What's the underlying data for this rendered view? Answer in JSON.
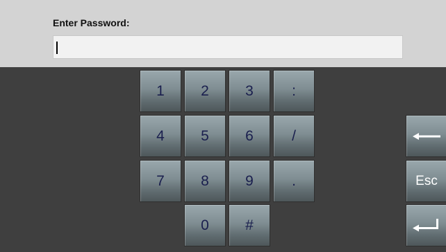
{
  "prompt": {
    "label": "Enter Password:"
  },
  "password": {
    "value": ""
  },
  "keypad": {
    "rows": [
      [
        "1",
        "2",
        "3",
        ":"
      ],
      [
        "4",
        "5",
        "6",
        "/"
      ],
      [
        "7",
        "8",
        "9",
        "."
      ],
      [
        "0",
        "#"
      ]
    ]
  },
  "side_keys": {
    "backspace_icon": "backspace-arrow-icon",
    "esc_label": "Esc",
    "enter_icon": "enter-return-icon"
  },
  "colors": {
    "header_bg": "#d3d3d3",
    "body_bg": "#3f3f3f",
    "key_text": "#1a1f4e"
  }
}
